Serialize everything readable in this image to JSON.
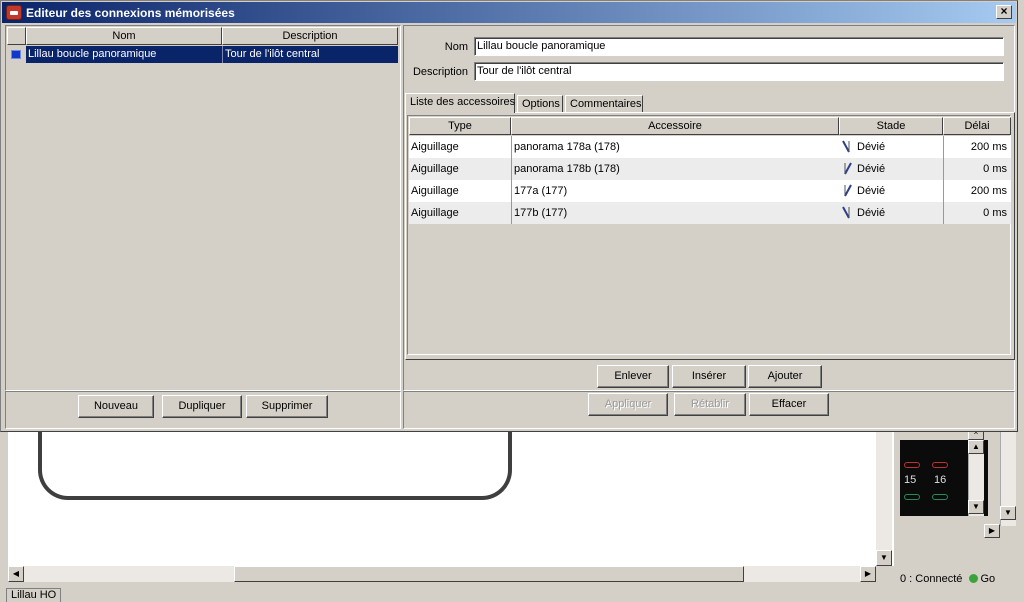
{
  "dialog": {
    "title": "Editeur des connexions mémorisées",
    "close_glyph": "×"
  },
  "connections_list": {
    "columns": [
      "Nom",
      "Description"
    ],
    "rows": [
      {
        "name": "Lillau boucle panoramique",
        "description": "Tour de l'ilôt central",
        "selected": true
      }
    ]
  },
  "left_buttons": {
    "new": "Nouveau",
    "duplicate": "Dupliquer",
    "delete": "Supprimer"
  },
  "form": {
    "name_label": "Nom",
    "name_value": "Lillau boucle panoramique",
    "description_label": "Description",
    "description_value": "Tour de l'ilôt central"
  },
  "tabs": [
    "Liste des accessoires",
    "Options",
    "Commentaires"
  ],
  "accessories": {
    "columns": [
      "Type",
      "Accessoire",
      "Stade",
      "Délai"
    ],
    "rows": [
      {
        "type": "Aiguillage",
        "accessory": "panorama 178a (178)",
        "state": "Dévié",
        "delay": "200 ms",
        "icon": "switch-left-icon"
      },
      {
        "type": "Aiguillage",
        "accessory": "panorama 178b (178)",
        "state": "Dévié",
        "delay": "0 ms",
        "icon": "switch-right-icon"
      },
      {
        "type": "Aiguillage",
        "accessory": "177a (177)",
        "state": "Dévié",
        "delay": "200 ms",
        "icon": "switch-right-icon"
      },
      {
        "type": "Aiguillage",
        "accessory": "177b (177)",
        "state": "Dévié",
        "delay": "0 ms",
        "icon": "switch-left-icon"
      }
    ]
  },
  "list_buttons": {
    "remove": "Enlever",
    "insert": "Insérer",
    "add": "Ajouter"
  },
  "action_buttons": {
    "apply": "Appliquer",
    "restore": "Rétablir",
    "clear": "Effacer"
  },
  "background": {
    "layout_tab": "Lillau HO",
    "block_labels": [
      "15",
      "16"
    ],
    "status_prefix": "0 :",
    "status_text": "Connecté",
    "go_label": "Go",
    "status_color": "#3aa43a"
  },
  "colors": {
    "title_gradient_start": "#0a246a",
    "title_gradient_end": "#a6caf0",
    "selection": "#0a246a",
    "face": "#d4d0c8"
  }
}
